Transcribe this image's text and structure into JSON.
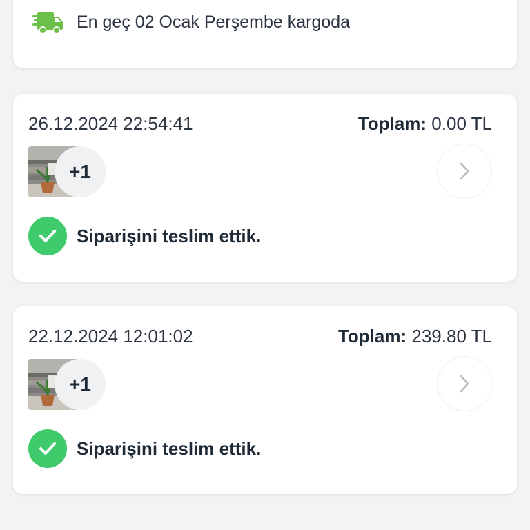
{
  "shipping": {
    "icon": "truck-icon",
    "text": "En geç 02 Ocak Perşembe kargoda",
    "icon_color": "#6cc04a"
  },
  "orders": [
    {
      "date": "26.12.2024 22:54:41",
      "total_label": "Toplam:",
      "total_value": "0.00 TL",
      "extra_count": "+1",
      "status": "Siparişini teslim ettik.",
      "status_icon": "check-icon"
    },
    {
      "date": "22.12.2024 12:01:02",
      "total_label": "Toplam:",
      "total_value": "239.80 TL",
      "extra_count": "+1",
      "status": "Siparişini teslim ettik.",
      "status_icon": "check-icon"
    }
  ],
  "colors": {
    "success_green": "#3fcb6b",
    "background": "#f2f3f5",
    "card": "#ffffff"
  }
}
